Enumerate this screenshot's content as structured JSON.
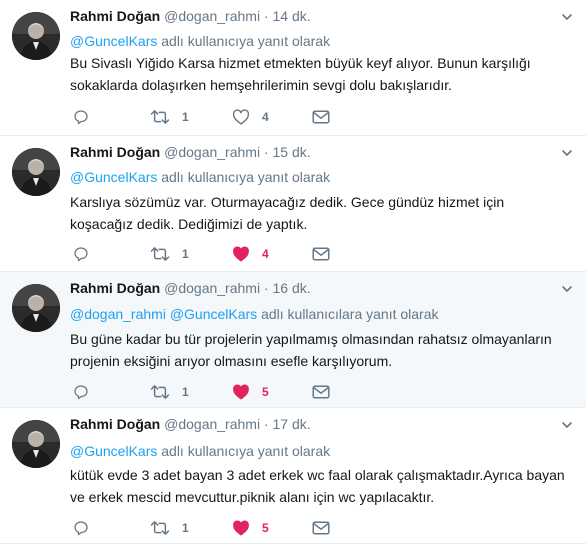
{
  "tweets": [
    {
      "name": "Rahmi Doğan",
      "handle": "@dogan_rahmi",
      "dot": "·",
      "time": "14 dk.",
      "reply_mentions": [
        "@GuncelKars"
      ],
      "reply_suffix": " adlı kullanıcıya yanıt olarak",
      "text": "Bu Sivaslı Yiğido Karsa hizmet etmekten büyük keyf alıyor. Bunun karşılığı sokaklarda dolaşırken hemşehrilerimin sevgi dolu bakışlarıdır.",
      "retweets": "1",
      "likes": "4",
      "liked": false
    },
    {
      "name": "Rahmi Doğan",
      "handle": "@dogan_rahmi",
      "dot": "·",
      "time": "15 dk.",
      "reply_mentions": [
        "@GuncelKars"
      ],
      "reply_suffix": " adlı kullanıcıya yanıt olarak",
      "text": "Karslıya sözümüz var. Oturmayacağız dedik. Gece gündüz hizmet için koşacağız dedik. Dediğimizi de yaptık.",
      "retweets": "1",
      "likes": "4",
      "liked": true
    },
    {
      "name": "Rahmi Doğan",
      "handle": "@dogan_rahmi",
      "dot": "·",
      "time": "16 dk.",
      "reply_mentions": [
        "@dogan_rahmi",
        "@GuncelKars"
      ],
      "reply_suffix": " adlı kullanıcılara yanıt olarak",
      "text": "Bu güne kadar bu tür projelerin yapılmamış olmasından rahatsız olmayanların projenin eksiğini arıyor olmasını esefle karşılıyorum.",
      "retweets": "1",
      "likes": "5",
      "liked": true
    },
    {
      "name": "Rahmi Doğan",
      "handle": "@dogan_rahmi",
      "dot": "·",
      "time": "17 dk.",
      "reply_mentions": [
        "@GuncelKars"
      ],
      "reply_suffix": " adlı kullanıcıya yanıt olarak",
      "text": "kütük evde 3 adet bayan 3 adet erkek wc faal olarak çalışmaktadır.Ayrıca bayan ve erkek mescid mevcuttur.piknik alanı için wc yapılacaktır.",
      "retweets": "1",
      "likes": "5",
      "liked": true
    }
  ],
  "colors": {
    "accent": "#1da1f2",
    "muted": "#657786",
    "like": "#e0245e",
    "highlight_bg": "#f5f8fa",
    "divider": "#e6ecf0"
  },
  "icons": [
    "reply-icon",
    "retweet-icon",
    "like-icon",
    "message-icon",
    "caret-down-icon"
  ]
}
